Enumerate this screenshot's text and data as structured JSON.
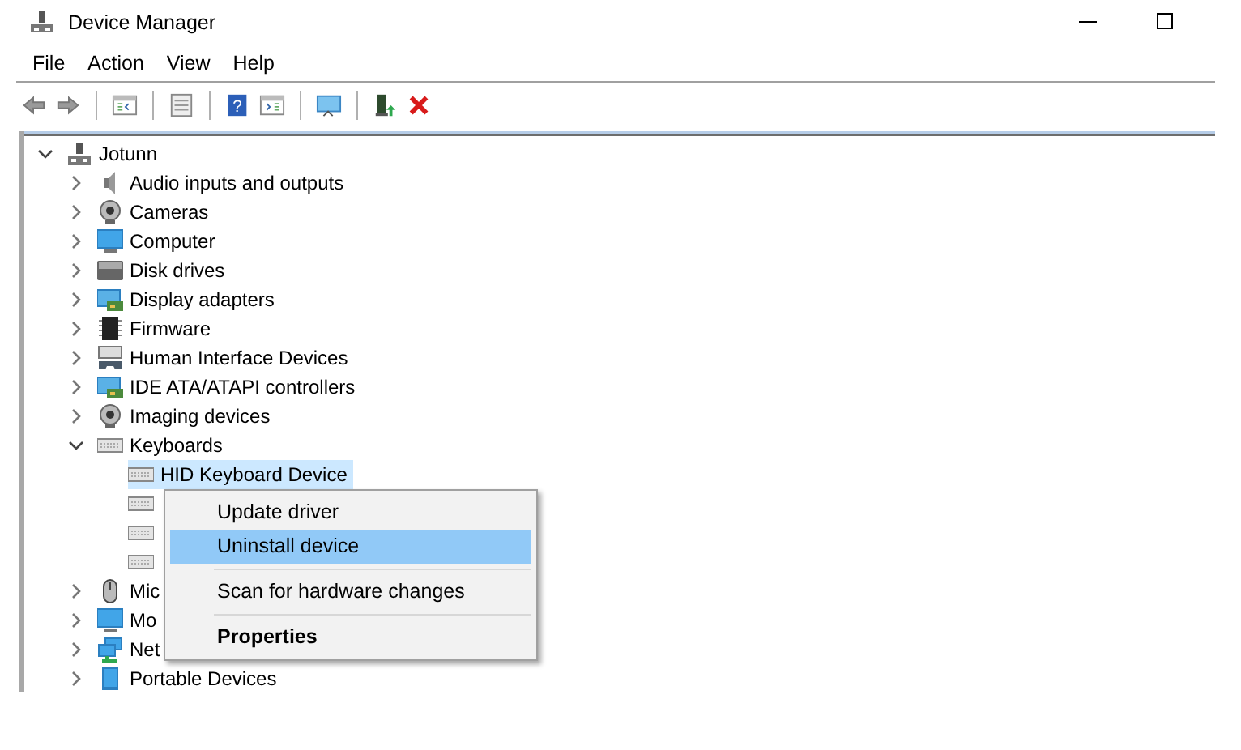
{
  "window": {
    "title": "Device Manager"
  },
  "menu": [
    "File",
    "Action",
    "View",
    "Help"
  ],
  "toolbar": [
    {
      "kind": "back"
    },
    {
      "kind": "forward"
    },
    {
      "kind": "sep"
    },
    {
      "kind": "tree"
    },
    {
      "kind": "sep"
    },
    {
      "kind": "props"
    },
    {
      "kind": "sep"
    },
    {
      "kind": "help",
      "glyph": "?"
    },
    {
      "kind": "pane"
    },
    {
      "kind": "sep"
    },
    {
      "kind": "scan"
    },
    {
      "kind": "sep"
    },
    {
      "kind": "update"
    },
    {
      "kind": "uninstall"
    }
  ],
  "tree": [
    {
      "label": "Jotunn",
      "kind": "computer",
      "expanded": true,
      "selected": false,
      "children": [
        {
          "label": "Audio inputs and outputs",
          "kind": "speaker",
          "expanded": false,
          "selected": false
        },
        {
          "label": "Cameras",
          "kind": "camera",
          "expanded": false,
          "selected": false
        },
        {
          "label": "Computer",
          "kind": "monitor",
          "expanded": false,
          "selected": false
        },
        {
          "label": "Disk drives",
          "kind": "disk",
          "expanded": false,
          "selected": false
        },
        {
          "label": "Display adapters",
          "kind": "adapter",
          "expanded": false,
          "selected": false
        },
        {
          "label": "Firmware",
          "kind": "chip",
          "expanded": false,
          "selected": false
        },
        {
          "label": "Human Interface Devices",
          "kind": "hid",
          "expanded": false,
          "selected": false
        },
        {
          "label": "IDE ATA/ATAPI controllers",
          "kind": "adapter",
          "expanded": false,
          "selected": false
        },
        {
          "label": "Imaging devices",
          "kind": "camera",
          "expanded": false,
          "selected": false
        },
        {
          "label": "Keyboards",
          "kind": "keyboard",
          "expanded": true,
          "selected": false,
          "children": [
            {
              "label": "HID Keyboard Device",
              "kind": "keyboard",
              "selected": true
            },
            {
              "kind": "keyboard",
              "selected": false
            },
            {
              "kind": "keyboard",
              "selected": false
            },
            {
              "kind": "keyboard",
              "selected": false
            }
          ]
        },
        {
          "label": "Mic",
          "kind": "mouse",
          "expanded": false,
          "selected": false
        },
        {
          "label": "Mo",
          "kind": "monitor",
          "expanded": false,
          "selected": false
        },
        {
          "label": "Net",
          "kind": "network",
          "expanded": false,
          "selected": false
        },
        {
          "label": "Portable Devices",
          "kind": "portable",
          "expanded": false,
          "selected": false
        }
      ]
    }
  ],
  "context_menu": [
    {
      "kind": "item",
      "label": "Update driver",
      "selected": false,
      "bold": false
    },
    {
      "kind": "item",
      "label": "Uninstall device",
      "selected": true,
      "bold": false
    },
    {
      "kind": "separator"
    },
    {
      "kind": "item",
      "label": "Scan for hardware changes",
      "selected": false,
      "bold": false
    },
    {
      "kind": "separator"
    },
    {
      "kind": "item",
      "label": "Properties",
      "selected": false,
      "bold": true
    }
  ]
}
